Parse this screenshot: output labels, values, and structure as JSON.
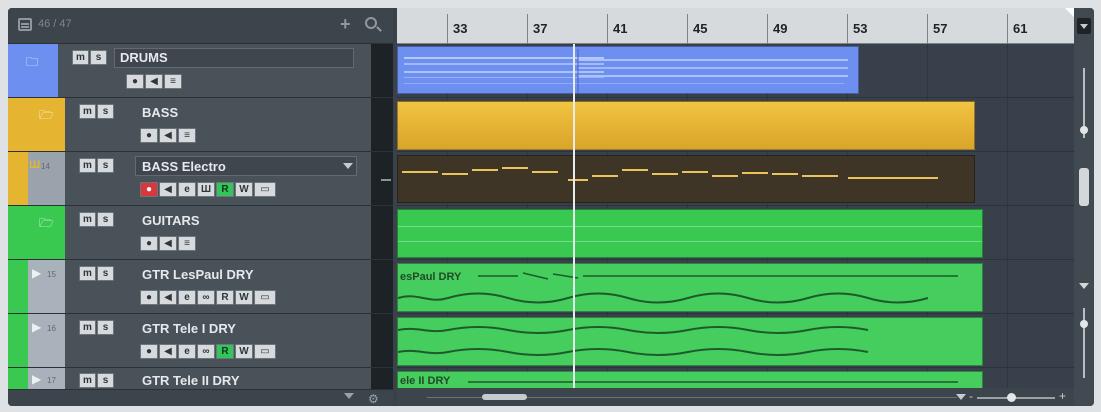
{
  "header": {
    "track_count": "46 / 47",
    "add_glyph": "+"
  },
  "buttons": {
    "mute": "m",
    "solo": "s",
    "edit": "e",
    "read": "R",
    "write": "W",
    "lanes": "▭",
    "monitor": "◀",
    "record": "●",
    "inserts": "≡",
    "link": "∞",
    "inst": "Ш"
  },
  "tracks": [
    {
      "name": "DRUMS",
      "color": "#6d8ff0",
      "kind": "folder",
      "number": ""
    },
    {
      "name": "BASS",
      "color": "#e5b531",
      "kind": "folder",
      "number": ""
    },
    {
      "name": "BASS Electro",
      "color": "#e5b531",
      "kind": "instrument",
      "number": "14"
    },
    {
      "name": "GUITARS",
      "color": "#39c850",
      "kind": "folder",
      "number": ""
    },
    {
      "name": "GTR LesPaul DRY",
      "color": "#a9b2bb",
      "kind": "audio",
      "number": "15"
    },
    {
      "name": "GTR Tele I DRY",
      "color": "#a9b2bb",
      "kind": "audio",
      "number": "16"
    },
    {
      "name": "GTR Tele II DRY",
      "color": "#a9b2bb",
      "kind": "audio",
      "number": "17"
    }
  ],
  "ruler": {
    "bars": [
      "33",
      "37",
      "41",
      "45",
      "49",
      "53",
      "57",
      "61"
    ]
  },
  "parts": {
    "guitar1_label": "esPaul DRY",
    "guitar3_label": "ele II DRY"
  },
  "colors": {
    "drums": "#6d8ff0",
    "bass": "#e5b531",
    "guitars": "#39c850",
    "midi_bg": "#3e3526",
    "midi_note": "#e8c45a"
  }
}
